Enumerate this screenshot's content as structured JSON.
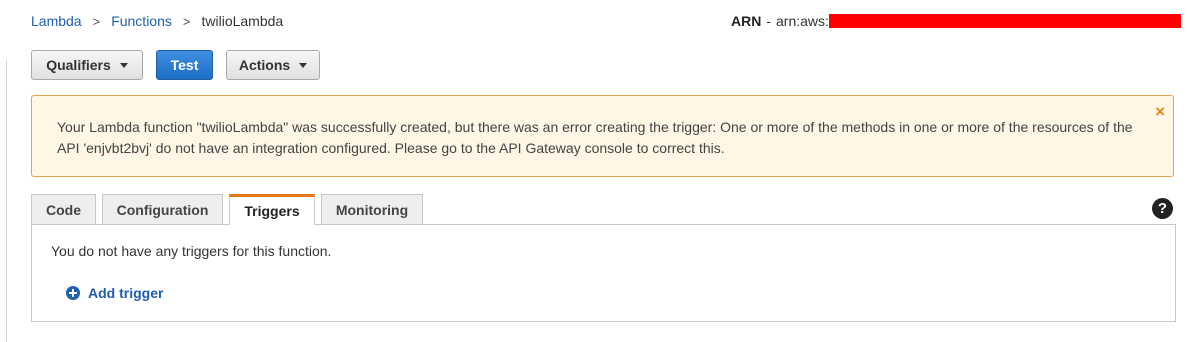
{
  "breadcrumb": {
    "items": [
      "Lambda",
      "Functions",
      "twilioLambda"
    ],
    "separator": ">"
  },
  "arn": {
    "label": "ARN",
    "separator": "-",
    "value": "arn:aws:"
  },
  "toolbar": {
    "qualifiers_label": "Qualifiers",
    "test_label": "Test",
    "actions_label": "Actions"
  },
  "alert": {
    "message": "Your Lambda function \"twilioLambda\" was successfully created, but there was an error creating the trigger: One or more of the methods in one or more of the resources of the API 'enjvbt2bvj' do not have an integration configured. Please go to the API Gateway console to correct this.",
    "close_glyph": "×"
  },
  "tabs": [
    {
      "label": "Code",
      "active": false
    },
    {
      "label": "Configuration",
      "active": false
    },
    {
      "label": "Triggers",
      "active": true
    },
    {
      "label": "Monitoring",
      "active": false
    }
  ],
  "help_glyph": "?",
  "triggers_panel": {
    "empty_message": "You do not have any triggers for this function.",
    "add_trigger_label": "Add trigger"
  },
  "colors": {
    "link": "#1f5faf",
    "primary_button": "#1e6fc7",
    "alert_background": "#fff6e5",
    "alert_border": "#e0a74a",
    "active_tab_accent": "#e47911",
    "redaction": "#ff0000"
  }
}
